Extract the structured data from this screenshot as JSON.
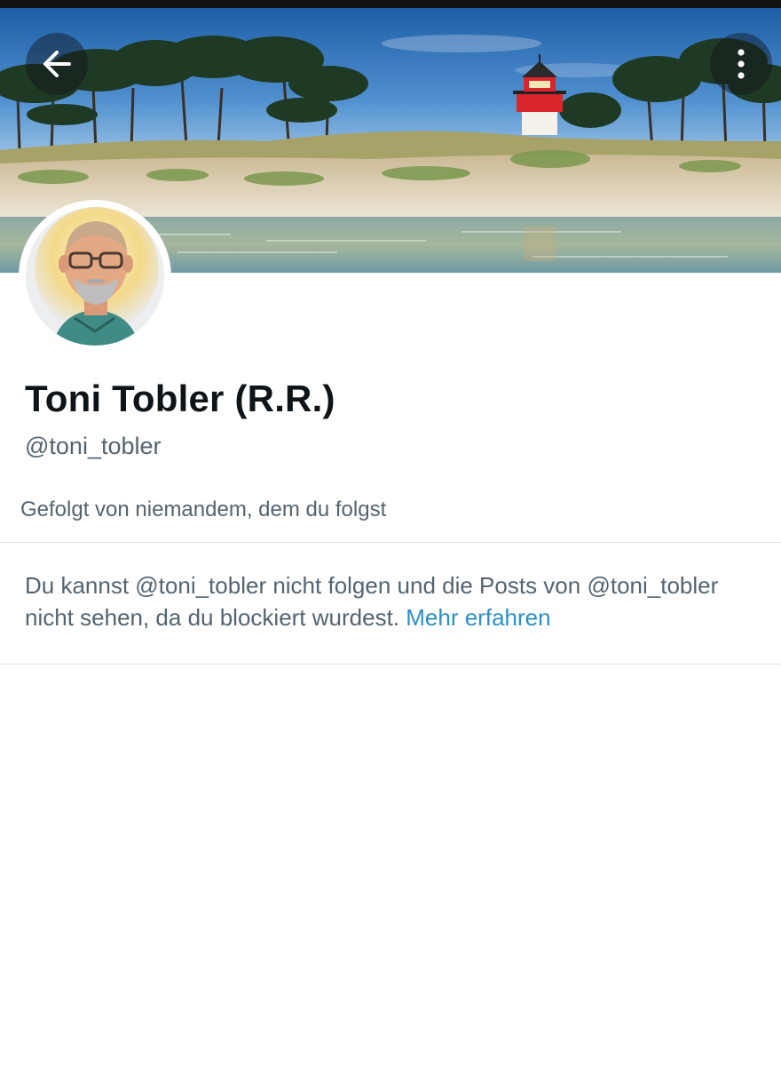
{
  "profile": {
    "display_name": "Toni Tobler (R.R.)",
    "handle": "@toni_tobler",
    "followed_by": "Gefolgt von niemandem, dem du folgst"
  },
  "blocked_notice": {
    "text": "Du kannst @toni_tobler nicht folgen und die Posts von @toni_tobler nicht sehen, da du blockiert wurdest.",
    "link_label": "Mehr erfahren"
  },
  "icons": {
    "back": "arrow-left-icon",
    "more": "more-vertical-icon"
  },
  "colors": {
    "text_primary": "#0f1419",
    "text_secondary": "#536471",
    "link": "#2b8fc5",
    "divider": "#dfe3e6"
  }
}
